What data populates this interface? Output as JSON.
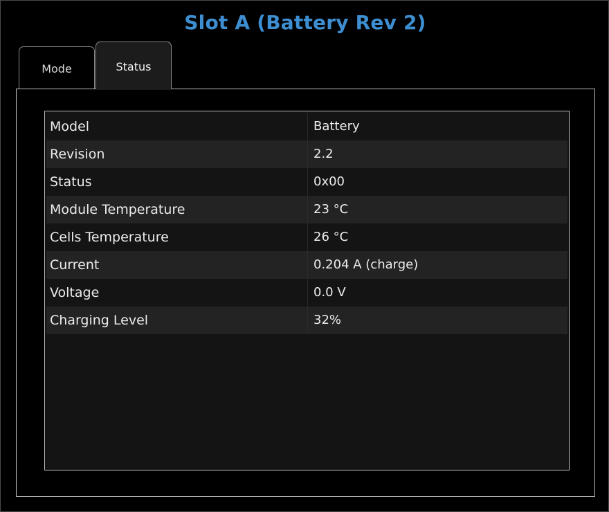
{
  "window": {
    "title": "Slot A (Battery Rev 2)"
  },
  "tabs": [
    {
      "label": "Mode",
      "active": false
    },
    {
      "label": "Status",
      "active": true
    }
  ],
  "status_table": {
    "rows": [
      {
        "key": "Model",
        "value": "Battery"
      },
      {
        "key": "Revision",
        "value": "2.2"
      },
      {
        "key": "Status",
        "value": "0x00"
      },
      {
        "key": "Module Temperature",
        "value": "23 °C"
      },
      {
        "key": "Cells Temperature",
        "value": "26 °C"
      },
      {
        "key": "Current",
        "value": "0.204 A (charge)"
      },
      {
        "key": "Voltage",
        "value": "0.0 V"
      },
      {
        "key": "Charging Level",
        "value": "32%"
      }
    ]
  },
  "colors": {
    "title": "#3d8fd1",
    "background": "#000000",
    "row": "#141414",
    "row_alt": "#232323",
    "border": "#bdbdbd"
  }
}
